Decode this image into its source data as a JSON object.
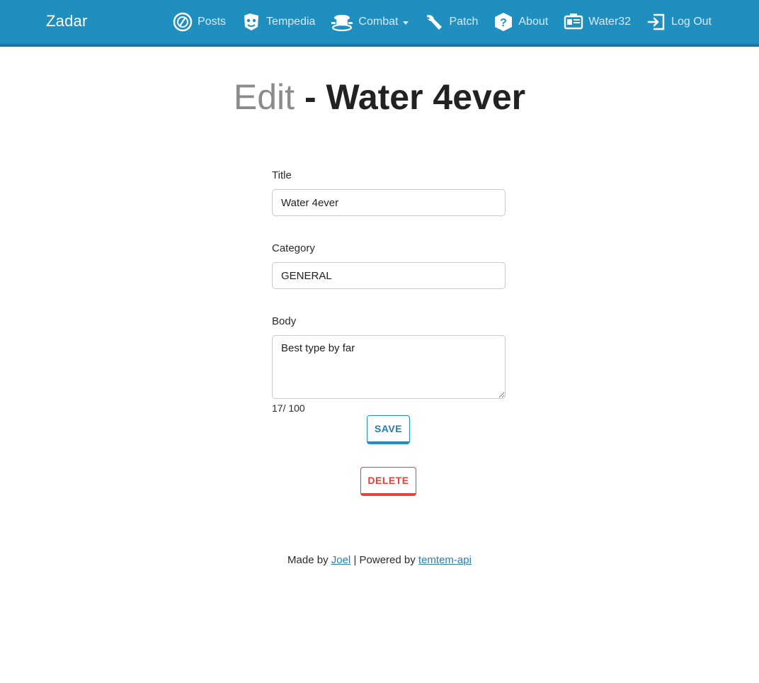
{
  "navbar": {
    "brand": "Zadar",
    "items": [
      {
        "label": "Posts",
        "icon": "posts-icon"
      },
      {
        "label": "Tempedia",
        "icon": "tempedia-icon"
      },
      {
        "label": "Combat",
        "icon": "combat-icon",
        "dropdown": true
      },
      {
        "label": "Patch",
        "icon": "wrench-icon"
      },
      {
        "label": "About",
        "icon": "question-icon"
      },
      {
        "label": "Water32",
        "icon": "id-card-icon"
      },
      {
        "label": "Log Out",
        "icon": "logout-icon"
      }
    ]
  },
  "page": {
    "title_prefix": "Edit",
    "title_separator": " - ",
    "title_name": "Water 4ever"
  },
  "form": {
    "title_label": "Title",
    "title_value": "Water 4ever",
    "category_label": "Category",
    "category_value": "GENERAL",
    "body_label": "Body",
    "body_value": "Best type by far",
    "counter": "17/ 100",
    "save_label": "SAVE",
    "delete_label": "DELETE"
  },
  "footer": {
    "made_by_text": "Made by ",
    "author_link": "Joel",
    "separator_text": " | Powered by ",
    "api_link": "temtem-api"
  },
  "colors": {
    "navbar": "#1f8fbf",
    "primary": "#1f8fbf",
    "danger": "#e8403a",
    "link": "#2b7fb3"
  }
}
